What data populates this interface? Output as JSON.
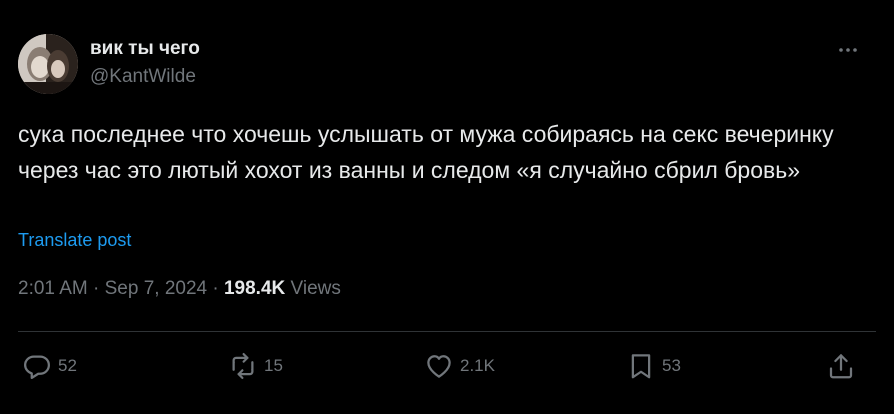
{
  "tweet": {
    "display_name": "вик ты чего",
    "handle": "@KantWilde",
    "text": "сука последнее что хочешь услышать от мужа собираясь на секс вечеринку через час это лютый хохот из ванны и следом «я случайно сбрил бровь»",
    "translate_label": "Translate post",
    "time": "2:01 AM",
    "sep1": "·",
    "date": "Sep 7, 2024",
    "sep2": "·",
    "views_count": "198.4K",
    "views_label": "Views"
  },
  "actions": {
    "replies": "52",
    "reposts": "15",
    "likes": "2.1K",
    "bookmarks": "53"
  },
  "icons": {
    "more": "more-horizontal-icon",
    "reply": "reply-icon",
    "repost": "repost-icon",
    "like": "heart-icon",
    "bookmark": "bookmark-icon",
    "share": "share-icon"
  },
  "colors": {
    "background": "#000000",
    "text": "#e7e9ea",
    "secondary": "#71767b",
    "link": "#1d9bf0",
    "divider": "#2f3336"
  }
}
